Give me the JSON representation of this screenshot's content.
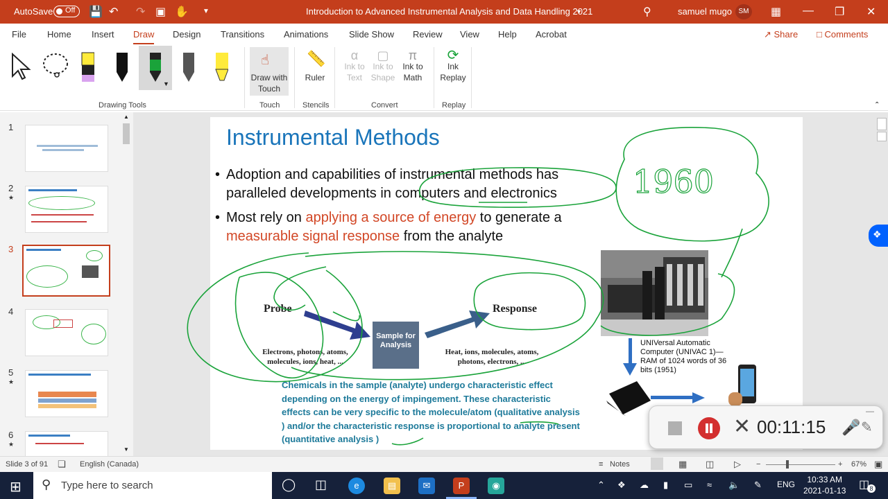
{
  "titlebar": {
    "autosave_label": "AutoSave",
    "autosave_state": "Off",
    "doc_title": "Introduction to Advanced Instrumental Analysis and Data Handling 2021",
    "user_name": "samuel mugo",
    "user_initials": "SM"
  },
  "tabs": [
    "File",
    "Home",
    "Insert",
    "Draw",
    "Design",
    "Transitions",
    "Animations",
    "Slide Show",
    "Review",
    "View",
    "Help",
    "Acrobat"
  ],
  "tab_active": "Draw",
  "share_label": "Share",
  "comments_label": "Comments",
  "ribbon": {
    "groups": {
      "drawing_tools": "Drawing Tools",
      "touch": "Touch",
      "stencils": "Stencils",
      "convert": "Convert",
      "replay": "Replay"
    },
    "draw_with_touch": "Draw with Touch",
    "ruler": "Ruler",
    "ink_to_text": "Ink to Text",
    "ink_to_shape": "Ink to Shape",
    "ink_to_math": "Ink to Math",
    "ink_replay": "Ink Replay"
  },
  "thumbnails": {
    "numbers": [
      "1",
      "2",
      "3",
      "4",
      "5",
      "6"
    ],
    "selected": 3
  },
  "slide": {
    "title": "Instrumental Methods",
    "bullet1": "Adoption and capabilities of instrumental methods has paralleled developments in computers and electronics",
    "bullet2_part1": "Most rely on ",
    "bullet2_red1": "applying a source of energy",
    "bullet2_part2": " to generate a ",
    "bullet2_red2": "measurable signal response",
    "bullet2_part3": " from the analyte",
    "probe": "Probe",
    "probe_sub": "Electrons, photons, atoms, molecules, ions, heat, ...",
    "sample_box": "Sample for Analysis",
    "response": "Response",
    "response_sub": "Heat, ions, molecules, atoms, photons, electrons, ...",
    "univac": "UNIVersal Automatic Computer (UNIVAC 1)—RAM of 1024  words of 36 bits (1951)",
    "teal_text": "Chemicals in the sample (analyte) undergo characteristic effect depending on the energy of impingement. These characteristic effects can be very specific to the molecule/atom (qualitative analysis ) and/or the characteristic response is proportional to analyte present (quantitative analysis )",
    "ink_note": "1960"
  },
  "recorder": {
    "time": "00:11:15"
  },
  "status": {
    "slide_info": "Slide 3 of 91",
    "language": "English (Canada)",
    "notes": "Notes",
    "zoom": "67%"
  },
  "taskbar": {
    "search_placeholder": "Type here to search",
    "lang": "ENG",
    "time": "10:33 AM",
    "date": "2021-01-13",
    "notifications": "8"
  },
  "colors": {
    "accent": "#c43e1c",
    "title_blue": "#1a75ba",
    "bullet_red": "#d24726",
    "ink_green": "#1aa33a",
    "teal": "#1d7a9a"
  }
}
